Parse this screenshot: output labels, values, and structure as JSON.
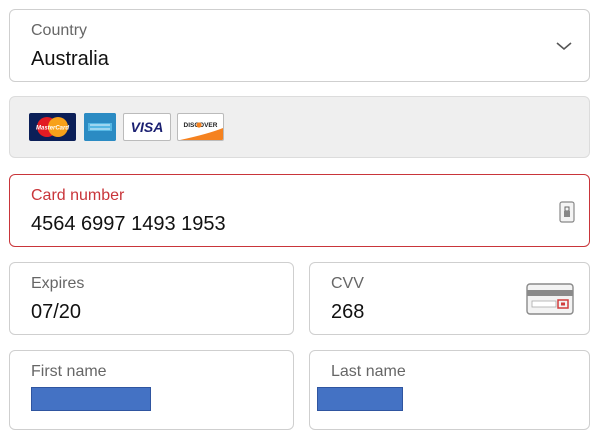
{
  "country": {
    "label": "Country",
    "value": "Australia",
    "icon": "chevron-down-icon"
  },
  "payment_brands": [
    {
      "name": "mastercard-logo",
      "text": "MasterCard"
    },
    {
      "name": "amex-logo",
      "text": ""
    },
    {
      "name": "visa-logo",
      "text": "VISA"
    },
    {
      "name": "discover-logo",
      "text": "DISCOVER"
    }
  ],
  "card_number": {
    "label": "Card number",
    "value": "4564 6997 1493 1953",
    "state": "error",
    "icon": "lock-icon"
  },
  "expires": {
    "label": "Expires",
    "value": "07/20"
  },
  "cvv": {
    "label": "CVV",
    "value": "268",
    "icon": "card-back-icon"
  },
  "first_name": {
    "label": "First name",
    "value_redacted": true
  },
  "last_name": {
    "label": "Last name",
    "value_redacted": true
  },
  "colors": {
    "error": "#c9353a",
    "border": "#cfcfcf",
    "redaction": "#4472c4",
    "cards_bar_bg": "#efefef"
  }
}
